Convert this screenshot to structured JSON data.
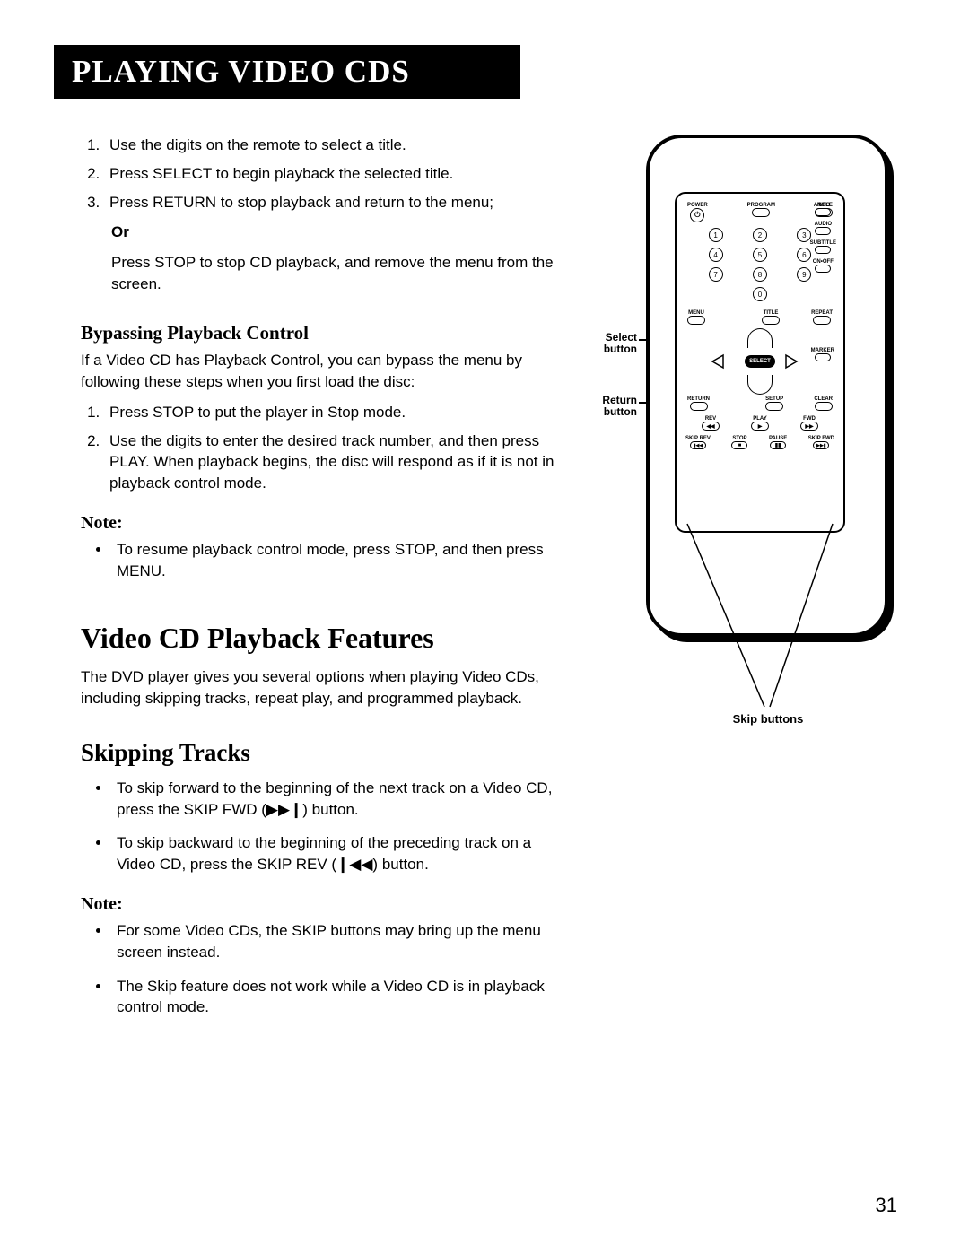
{
  "title_bar": "PLAYING VIDEO CDS",
  "steps": [
    "Use the digits on the remote to select a title.",
    "Press SELECT to begin playback the selected title.",
    "Press RETURN to stop playback and return to the menu;"
  ],
  "or_label": "Or",
  "or_text": "Press STOP to stop CD playback, and remove the menu from the screen.",
  "bypass": {
    "heading": "Bypassing Playback Control",
    "intro": "If a Video CD has Playback Control, you can bypass the menu by following these steps when you first load the disc:",
    "steps": [
      "Press STOP to put the player in Stop mode.",
      "Use the digits to enter the desired track number, and then press PLAY. When playback begins, the disc will respond as if it is not in playback control mode."
    ]
  },
  "note1": {
    "heading": "Note:",
    "items": [
      "To resume playback control mode, press STOP, and then press MENU."
    ]
  },
  "features": {
    "heading": "Video CD Playback Features",
    "intro": "The DVD player gives you several options when playing Video CDs, including skipping tracks, repeat play, and programmed playback."
  },
  "skipping": {
    "heading": "Skipping Tracks",
    "items": [
      "To skip forward to the beginning of the next track on a Video CD, press the SKIP FWD (▶▶❙) button.",
      "To skip backward to the beginning of the preceding track on a Video CD, press the SKIP REV (❙◀◀) button."
    ]
  },
  "note2": {
    "heading": "Note:",
    "items": [
      "For some Video CDs, the SKIP buttons may bring up the menu screen instead.",
      "The Skip feature does not work while a Video CD is in playback control mode."
    ]
  },
  "page_number": "31",
  "remote": {
    "top_row": {
      "power": "POWER",
      "program": "PROGRAM",
      "info": "INFO"
    },
    "side": {
      "angle": "ANGLE",
      "audio": "AUDIO",
      "subtitle": "SUBTITLE",
      "onoff": "ON•OFF"
    },
    "digits": [
      "1",
      "2",
      "3",
      "4",
      "5",
      "6",
      "7",
      "8",
      "9",
      "0"
    ],
    "row_mtr": {
      "menu": "MENU",
      "title": "TITLE",
      "repeat": "REPEAT"
    },
    "marker": "MARKER",
    "select": "SELECT",
    "row_rsc": {
      "return": "RETURN",
      "setup": "SETUP",
      "clear": "CLEAR"
    },
    "row_rpf": {
      "rev": "REV",
      "play": "PLAY",
      "fwd": "FWD"
    },
    "row_sspf": {
      "skiprev": "SKIP REV",
      "stop": "STOP",
      "pause": "PAUSE",
      "skipfwd": "SKIP FWD"
    },
    "callouts": {
      "select": "Select button",
      "return": "Return button",
      "skip": "Skip buttons"
    }
  }
}
